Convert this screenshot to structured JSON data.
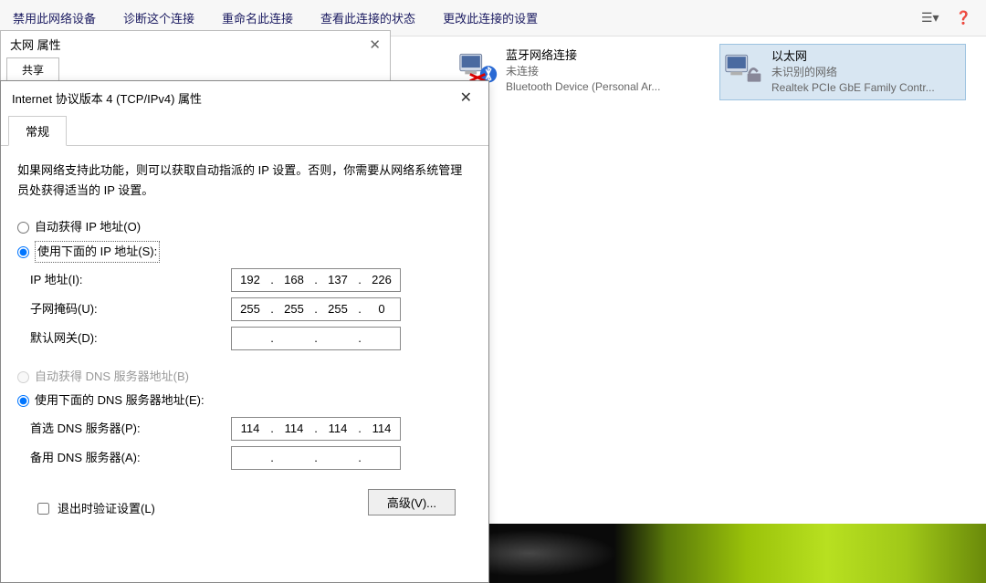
{
  "toolbar": {
    "items": [
      "禁用此网络设备",
      "诊断这个连接",
      "重命名此连接",
      "查看此连接的状态",
      "更改此连接的设置"
    ]
  },
  "adapters": [
    {
      "name": "蓝牙网络连接",
      "status": "未连接",
      "device": "Bluetooth Device (Personal Ar...",
      "selected": false
    },
    {
      "name": "以太网",
      "status": "未识别的网络",
      "device": "Realtek PCIe GbE Family Contr...",
      "selected": true
    }
  ],
  "eth_window": {
    "title": "太网 属性",
    "tab_share": "共享"
  },
  "ipv4": {
    "title": "Internet 协议版本 4 (TCP/IPv4) 属性",
    "tab_general": "常规",
    "description": "如果网络支持此功能，则可以获取自动指派的 IP 设置。否则，你需要从网络系统管理员处获得适当的 IP 设置。",
    "radio_auto_ip": "自动获得 IP 地址(O)",
    "radio_manual_ip": "使用下面的 IP 地址(S):",
    "label_ip": "IP 地址(I):",
    "label_mask": "子网掩码(U):",
    "label_gateway": "默认网关(D):",
    "ip": [
      "192",
      "168",
      "137",
      "226"
    ],
    "mask": [
      "255",
      "255",
      "255",
      "0"
    ],
    "gateway": [
      "",
      "",
      "",
      ""
    ],
    "radio_auto_dns": "自动获得 DNS 服务器地址(B)",
    "radio_manual_dns": "使用下面的 DNS 服务器地址(E):",
    "label_dns1": "首选 DNS 服务器(P):",
    "label_dns2": "备用 DNS 服务器(A):",
    "dns1": [
      "114",
      "114",
      "114",
      "114"
    ],
    "dns2": [
      "",
      "",
      "",
      ""
    ],
    "check_validate": "退出时验证设置(L)",
    "btn_advanced": "高级(V)..."
  }
}
